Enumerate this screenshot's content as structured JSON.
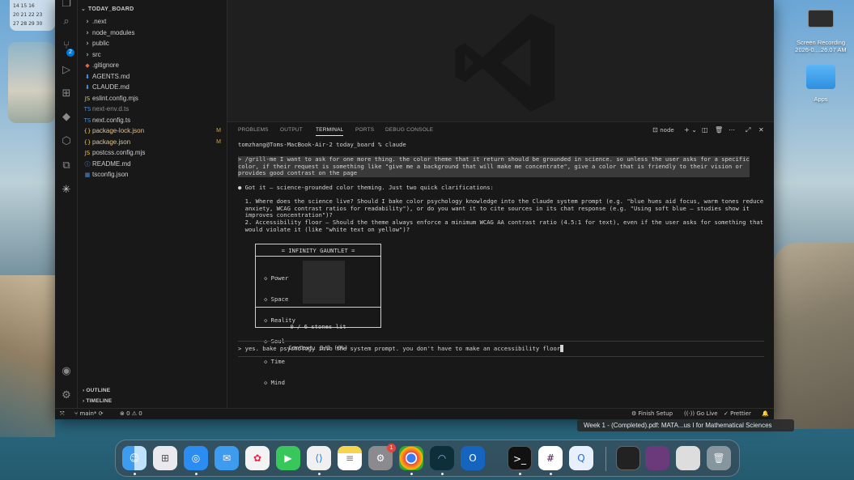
{
  "calendar": {
    "row1": "14 15 16",
    "row2": "20 21 22 23",
    "row3": "27 28 29 30"
  },
  "explorer": {
    "root": "TODAY_BOARD",
    "items": [
      {
        "name": ".next",
        "icon": "chevron-right-icon",
        "kind": "folder"
      },
      {
        "name": "node_modules",
        "icon": "chevron-right-icon",
        "kind": "folder"
      },
      {
        "name": "public",
        "icon": "chevron-right-icon",
        "kind": "folder"
      },
      {
        "name": "src",
        "icon": "chevron-right-icon",
        "kind": "folder"
      },
      {
        "name": ".gitignore",
        "icon": "git-icon",
        "kind": "file"
      },
      {
        "name": "AGENTS.md",
        "icon": "markdown-icon",
        "kind": "file"
      },
      {
        "name": "CLAUDE.md",
        "icon": "markdown-icon",
        "kind": "file"
      },
      {
        "name": "eslint.config.mjs",
        "icon": "js-icon",
        "kind": "file"
      },
      {
        "name": "next-env.d.ts",
        "icon": "ts-icon",
        "kind": "file"
      },
      {
        "name": "next.config.ts",
        "icon": "ts-icon",
        "kind": "file"
      },
      {
        "name": "package-lock.json",
        "icon": "json-icon",
        "kind": "file",
        "status": "M"
      },
      {
        "name": "package.json",
        "icon": "json-icon",
        "kind": "file",
        "status": "M"
      },
      {
        "name": "postcss.config.mjs",
        "icon": "js-icon",
        "kind": "file"
      },
      {
        "name": "README.md",
        "icon": "info-icon",
        "kind": "file"
      },
      {
        "name": "tsconfig.json",
        "icon": "ts-config-icon",
        "kind": "file"
      }
    ],
    "outline": "OUTLINE",
    "timeline": "TIMELINE"
  },
  "panel": {
    "tabs": [
      "PROBLEMS",
      "OUTPUT",
      "TERMINAL",
      "PORTS",
      "DEBUG CONSOLE"
    ],
    "active_tab": "TERMINAL",
    "shell": "node",
    "prompt": "tomzhang@Toms-MacBook-Air-2 today_board % claude",
    "user_msg": "> /grill-me I want to ask for one more thing. the color theme that it return should be grounded in science. so unless the user asks for a specific\ncolor, if their request is something like \"give me a background that will make me concentrate\", give a color that is friendly to their vision or\nprovides good contrast on the page",
    "reply_intro": "● Got it — science-grounded color theming. Just two quick clarifications:",
    "q1": "  1. Where does the science live? Should I bake color psychology knowledge into the Claude system prompt (e.g. \"blue hues aid focus, warm tones reduce\n  anxiety, WCAG contrast ratios for readability\"), or do you want it to cite sources in its chat response (e.g. \"Using soft blue — studies show it\n  improves concentration\")?",
    "q2": "  2. Accessibility floor — Should the theme always enforce a minimum WCAG AA contrast ratio (4.5:1 for text), even if the user asks for something that\n  would violate it (like \"white text on yellow\")?",
    "gauntlet": {
      "title": "= INFINITY GAUNTLET =",
      "stones": [
        "◇ Power",
        "◇ Space",
        "◇ Reality",
        "◇ Soul",
        "◇ Time",
        "◇ Mind"
      ],
      "count": "0 / 6 stones lit",
      "context": "Context: 0/2 (0%)"
    },
    "input": "> yes. bake psychology into the system prompt. you don't have to make an accessibility floor"
  },
  "statusbar": {
    "branch": "main*",
    "problems": "⊗ 0 ⚠ 0",
    "finish_setup": "Finish Setup",
    "go_live": "Go Live",
    "prettier": "Prettier"
  },
  "tooltip": "Week 1 - (Completed).pdf: MATA...us I for Mathematical Sciences",
  "desktop": {
    "recording_label": "Screen Recording\n2026-0....26.07 AM",
    "apps_label": "Apps"
  },
  "dock": {
    "badge_settings": "1",
    "apps": [
      "Finder",
      "Launchpad",
      "Safari",
      "Mail",
      "Photos",
      "FaceTime",
      "VS Code",
      "Notes",
      "System Settings",
      "Chrome",
      "Arc",
      "Outlook",
      "Terminal",
      "Slack",
      "Quick Share"
    ]
  }
}
